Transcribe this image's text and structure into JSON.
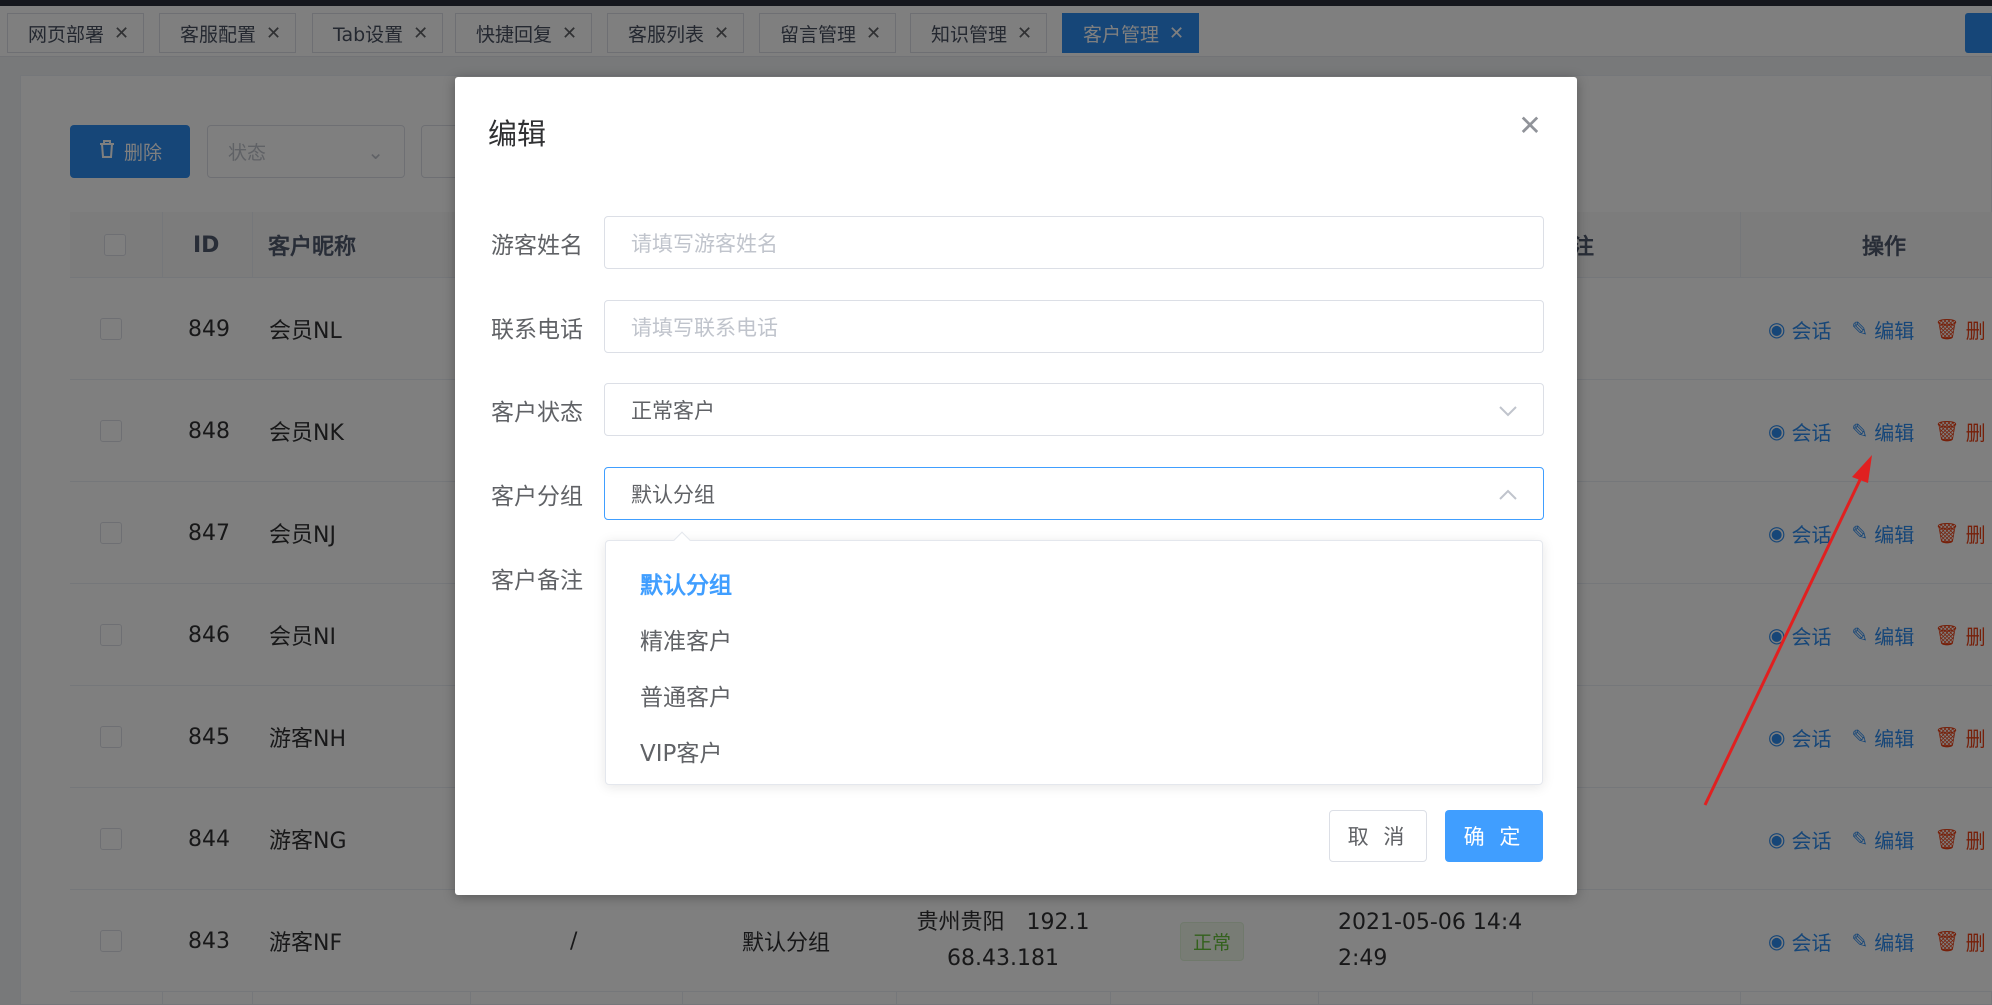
{
  "tabs": [
    {
      "label": "网页部署",
      "active": false
    },
    {
      "label": "客服配置",
      "active": false
    },
    {
      "label": "Tab设置",
      "active": false
    },
    {
      "label": "快捷回复",
      "active": false
    },
    {
      "label": "客服列表",
      "active": false
    },
    {
      "label": "留言管理",
      "active": false
    },
    {
      "label": "知识管理",
      "active": false
    },
    {
      "label": "客户管理",
      "active": true
    }
  ],
  "toolbar": {
    "delete_label": "删除",
    "status_placeholder": "状态"
  },
  "table": {
    "headers": {
      "id": "ID",
      "nickname": "客户昵称",
      "remark_tail": "注",
      "actions": "操作"
    },
    "rows": [
      {
        "id": "849",
        "nickname": "会员NL"
      },
      {
        "id": "848",
        "nickname": "会员NK"
      },
      {
        "id": "847",
        "nickname": "会员NJ"
      },
      {
        "id": "846",
        "nickname": "会员NI"
      },
      {
        "id": "845",
        "nickname": "游客NH"
      },
      {
        "id": "844",
        "nickname": "游客NG"
      },
      {
        "id": "843",
        "nickname": "游客NF",
        "phone": "/",
        "group": "默认分组",
        "location_line1": "贵州贵阳　192.1",
        "location_line2": "68.43.181",
        "status": "正常",
        "time_line1": "2021-05-06 14:4",
        "time_line2": "2:49"
      }
    ],
    "actions": {
      "chat": "会话",
      "edit": "编辑",
      "delete": "删"
    }
  },
  "modal": {
    "title": "编辑",
    "fields": {
      "name_label": "游客姓名",
      "name_placeholder": "请填写游客姓名",
      "phone_label": "联系电话",
      "phone_placeholder": "请填写联系电话",
      "status_label": "客户状态",
      "status_value": "正常客户",
      "group_label": "客户分组",
      "group_value": "默认分组",
      "remark_label": "客户备注"
    },
    "group_options": [
      "默认分组",
      "精准客户",
      "普通客户",
      "VIP客户"
    ],
    "cancel_label": "取 消",
    "ok_label": "确 定"
  },
  "colors": {
    "primary": "#2d8cf0",
    "modal_primary": "#409eff",
    "danger": "#ed4014",
    "annotation": "#e02020"
  }
}
